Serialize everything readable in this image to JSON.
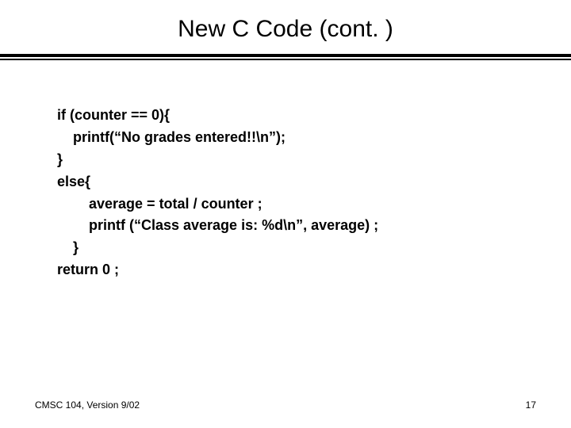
{
  "title": "New C Code (cont. )",
  "code": {
    "l1": "if (counter == 0){",
    "l2": "printf(“No grades entered!!\\n”);",
    "l3": "}",
    "l4": "else{",
    "l5": "average = total / counter ;",
    "l6": "printf (“Class average is: %d\\n”, average) ;",
    "l7": "}",
    "l8": "return 0 ;"
  },
  "footer": {
    "course": "CMSC 104, Version 9/02",
    "page": "17"
  }
}
